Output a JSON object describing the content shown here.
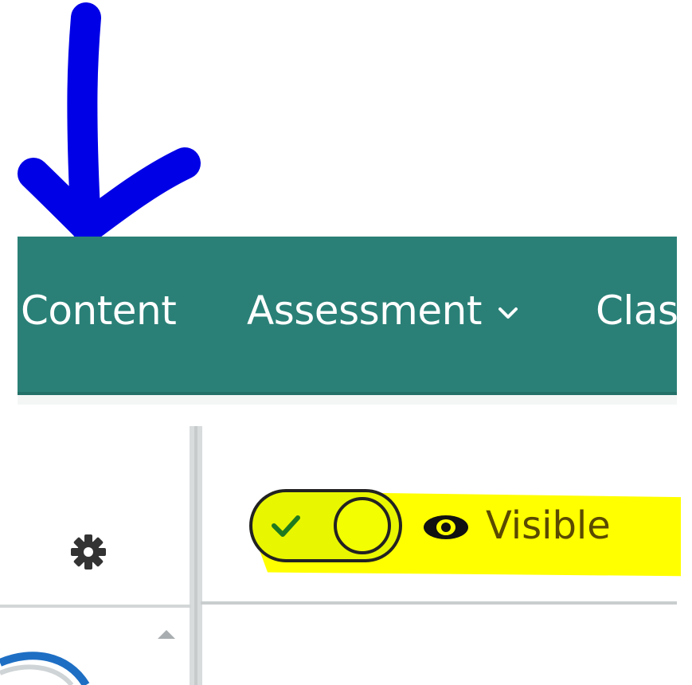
{
  "navbar": {
    "items": [
      {
        "label": "Content"
      },
      {
        "label": "Assessment",
        "has_dropdown": true
      },
      {
        "label": "Class"
      }
    ],
    "background": "#2a8077"
  },
  "settings": {
    "icon": "gear-icon"
  },
  "visibility": {
    "toggle_on": true,
    "icon": "eye-icon",
    "label": "Visible",
    "highlight_color": "#ffff00"
  },
  "annotation": {
    "arrow_color": "#0000e6"
  }
}
